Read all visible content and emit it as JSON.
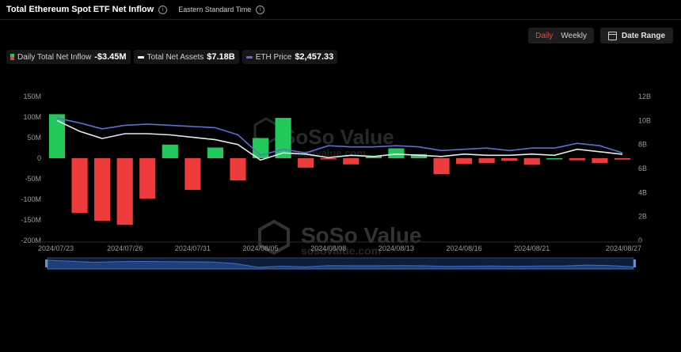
{
  "header": {
    "title": "Total Ethereum Spot ETF Net Inflow",
    "subtitle": "Eastern Standard Time"
  },
  "toolbar": {
    "daily_label": "Daily",
    "weekly_label": "Weekly",
    "date_range_label": "Date Range"
  },
  "legend": {
    "inflow_label": "Daily Total Net Inflow",
    "inflow_value": "-$3.45M",
    "assets_label": "Total Net Assets",
    "assets_value": "$7.18B",
    "price_label": "ETH Price",
    "price_value": "$2,457.33"
  },
  "watermark": {
    "brand": "SoSo Value",
    "url": "sosovalue.com"
  },
  "colors": {
    "positive": "#21c95b",
    "negative": "#ee3b3b",
    "assets_line": "#e8e8e8",
    "price_line": "#5b6fd6",
    "active_toggle": "#e8493f"
  },
  "chart_data": {
    "type": "bar",
    "x": [
      "2024/07/23",
      "2024/07/24",
      "2024/07/25",
      "2024/07/26",
      "2024/07/29",
      "2024/07/30",
      "2024/07/31",
      "2024/08/01",
      "2024/08/02",
      "2024/08/05",
      "2024/08/06",
      "2024/08/07",
      "2024/08/08",
      "2024/08/09",
      "2024/08/12",
      "2024/08/13",
      "2024/08/14",
      "2024/08/15",
      "2024/08/16",
      "2024/08/19",
      "2024/08/20",
      "2024/08/21",
      "2024/08/22",
      "2024/08/23",
      "2024/08/26",
      "2024/08/27"
    ],
    "x_tick_labels": [
      "2024/07/23",
      "2024/07/26",
      "2024/07/31",
      "2024/08/05",
      "2024/08/08",
      "2024/08/13",
      "2024/08/16",
      "2024/08/21",
      "2024/08/27"
    ],
    "series": [
      {
        "name": "Daily Total Net Inflow",
        "axis": "left",
        "unit": "M",
        "values": [
          107,
          -133,
          -152,
          -162,
          -98,
          33,
          -77,
          26,
          -54,
          49,
          98,
          -23,
          -2,
          -15,
          5,
          24,
          10,
          -39,
          -14,
          -12,
          -6,
          -16,
          0,
          -5,
          -12,
          -3.45
        ]
      },
      {
        "name": "Total Net Assets",
        "axis": "right",
        "unit": "B",
        "values": [
          10.0,
          9.1,
          8.5,
          8.9,
          8.9,
          8.8,
          8.6,
          8.4,
          8.0,
          6.7,
          7.3,
          7.2,
          6.9,
          7.1,
          7.0,
          7.2,
          7.1,
          7.0,
          7.2,
          7.1,
          7.1,
          7.2,
          7.1,
          7.6,
          7.4,
          7.18
        ]
      },
      {
        "name": "ETH Price",
        "axis": "right",
        "unit": "B-scale",
        "values": [
          10.2,
          9.8,
          9.3,
          9.6,
          9.7,
          9.6,
          9.5,
          9.4,
          8.8,
          7.1,
          7.6,
          7.3,
          7.9,
          7.8,
          7.8,
          7.9,
          7.8,
          7.5,
          7.6,
          7.7,
          7.5,
          7.7,
          7.7,
          8.1,
          7.9,
          7.3
        ]
      }
    ],
    "y_left": {
      "ticks": [
        "150M",
        "100M",
        "50M",
        "0",
        "-50M",
        "-100M",
        "-150M",
        "-200M"
      ],
      "ylim": [
        -200,
        150
      ]
    },
    "y_right": {
      "ticks": [
        "12B",
        "10B",
        "8B",
        "6B",
        "4B",
        "2B",
        "0"
      ],
      "ylim": [
        0,
        12
      ]
    },
    "grid": false
  }
}
